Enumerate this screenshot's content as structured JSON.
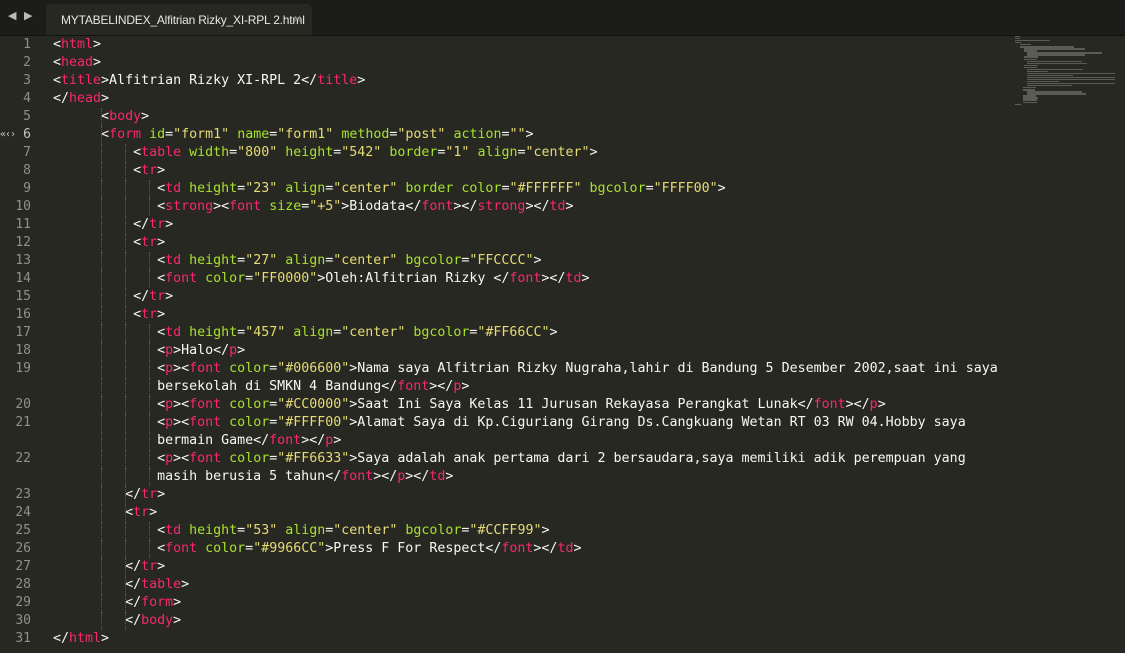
{
  "tabbar": {
    "nav_left_icon": "chevron-left-icon",
    "nav_right_icon": "chevron-right-icon",
    "tab_title": "MYTABELINDEX_Alfitrian Rizky_XI-RPL 2.html",
    "close_glyph": "×"
  },
  "colors": {
    "background": "#272822",
    "tag": "#f92672",
    "attribute": "#a6e22e",
    "string": "#e6db74",
    "text": "#f8f8f2"
  },
  "gutter": {
    "active_line": 6,
    "fold_marker_glyph": "«‹›"
  },
  "editor": {
    "lines": [
      {
        "num": "1",
        "indent": 0,
        "tokens": [
          [
            "p",
            "<"
          ],
          [
            "t",
            "html"
          ],
          [
            "p",
            ">"
          ]
        ]
      },
      {
        "num": "2",
        "indent": 0,
        "tokens": [
          [
            "p",
            "<"
          ],
          [
            "t",
            "head"
          ],
          [
            "p",
            ">"
          ]
        ]
      },
      {
        "num": "3",
        "indent": 0,
        "tokens": [
          [
            "p",
            "<"
          ],
          [
            "t",
            "title"
          ],
          [
            "p",
            ">Alfitrian Rizky XI-RPL 2</"
          ],
          [
            "t",
            "title"
          ],
          [
            "p",
            ">"
          ]
        ]
      },
      {
        "num": "4",
        "indent": 0,
        "tokens": [
          [
            "p",
            "</"
          ],
          [
            "t",
            "head"
          ],
          [
            "p",
            ">"
          ]
        ]
      },
      {
        "num": "5",
        "indent": 6,
        "tokens": [
          [
            "p",
            "<"
          ],
          [
            "t",
            "body"
          ],
          [
            "p",
            ">"
          ]
        ]
      },
      {
        "num": "6",
        "indent": 6,
        "tokens": [
          [
            "p",
            "<"
          ],
          [
            "t",
            "form"
          ],
          [
            "p",
            " "
          ],
          [
            "a",
            "id"
          ],
          [
            "p",
            "="
          ],
          [
            "s",
            "\"form1\""
          ],
          [
            "p",
            " "
          ],
          [
            "a",
            "name"
          ],
          [
            "p",
            "="
          ],
          [
            "s",
            "\"fo"
          ],
          [
            "s",
            "rm1\""
          ],
          [
            "p",
            " "
          ],
          [
            "a",
            "method"
          ],
          [
            "p",
            "="
          ],
          [
            "s",
            "\"post\""
          ],
          [
            "p",
            " "
          ],
          [
            "a",
            "action"
          ],
          [
            "p",
            "="
          ],
          [
            "s",
            "\"\""
          ],
          [
            "p",
            ">"
          ]
        ]
      },
      {
        "num": "7",
        "indent": 10,
        "tokens": [
          [
            "p",
            "<"
          ],
          [
            "t",
            "table"
          ],
          [
            "p",
            " "
          ],
          [
            "a",
            "width"
          ],
          [
            "p",
            "="
          ],
          [
            "s",
            "\"800\""
          ],
          [
            "p",
            " "
          ],
          [
            "a",
            "height"
          ],
          [
            "p",
            "="
          ],
          [
            "s",
            "\"542\""
          ],
          [
            "p",
            " "
          ],
          [
            "a",
            "border"
          ],
          [
            "p",
            "="
          ],
          [
            "s",
            "\"1\""
          ],
          [
            "p",
            " "
          ],
          [
            "a",
            "align"
          ],
          [
            "p",
            "="
          ],
          [
            "s",
            "\"center\""
          ],
          [
            "p",
            ">"
          ]
        ]
      },
      {
        "num": "8",
        "indent": 10,
        "tokens": [
          [
            "p",
            "<"
          ],
          [
            "t",
            "tr"
          ],
          [
            "p",
            ">"
          ]
        ]
      },
      {
        "num": "9",
        "indent": 13,
        "tokens": [
          [
            "p",
            "<"
          ],
          [
            "t",
            "td"
          ],
          [
            "p",
            " "
          ],
          [
            "a",
            "height"
          ],
          [
            "p",
            "="
          ],
          [
            "s",
            "\"23\""
          ],
          [
            "p",
            " "
          ],
          [
            "a",
            "align"
          ],
          [
            "p",
            "="
          ],
          [
            "s",
            "\"center\""
          ],
          [
            "p",
            " "
          ],
          [
            "a",
            "border"
          ],
          [
            "p",
            " "
          ],
          [
            "a",
            "color"
          ],
          [
            "p",
            "="
          ],
          [
            "s",
            "\"#FFFFFF\""
          ],
          [
            "p",
            " "
          ],
          [
            "a",
            "bgcolor"
          ],
          [
            "p",
            "="
          ],
          [
            "s",
            "\"FFFF00\""
          ],
          [
            "p",
            ">"
          ]
        ]
      },
      {
        "num": "10",
        "indent": 13,
        "tokens": [
          [
            "p",
            "<"
          ],
          [
            "t",
            "strong"
          ],
          [
            "p",
            "><"
          ],
          [
            "t",
            "font"
          ],
          [
            "p",
            " "
          ],
          [
            "a",
            "size"
          ],
          [
            "p",
            "="
          ],
          [
            "s",
            "\"+5\""
          ],
          [
            "p",
            ">Biodata</"
          ],
          [
            "t",
            "font"
          ],
          [
            "p",
            "></"
          ],
          [
            "t",
            "strong"
          ],
          [
            "p",
            "></"
          ],
          [
            "t",
            "td"
          ],
          [
            "p",
            ">"
          ]
        ]
      },
      {
        "num": "11",
        "indent": 10,
        "tokens": [
          [
            "p",
            "</"
          ],
          [
            "t",
            "tr"
          ],
          [
            "p",
            ">"
          ]
        ]
      },
      {
        "num": "12",
        "indent": 10,
        "tokens": [
          [
            "p",
            "<"
          ],
          [
            "t",
            "tr"
          ],
          [
            "p",
            ">"
          ]
        ]
      },
      {
        "num": "13",
        "indent": 13,
        "tokens": [
          [
            "p",
            "<"
          ],
          [
            "t",
            "td"
          ],
          [
            "p",
            " "
          ],
          [
            "a",
            "height"
          ],
          [
            "p",
            "="
          ],
          [
            "s",
            "\"27\""
          ],
          [
            "p",
            " "
          ],
          [
            "a",
            "align"
          ],
          [
            "p",
            "="
          ],
          [
            "s",
            "\"center\""
          ],
          [
            "p",
            " "
          ],
          [
            "a",
            "bgcolor"
          ],
          [
            "p",
            "="
          ],
          [
            "s",
            "\"FFCCCC\""
          ],
          [
            "p",
            ">"
          ]
        ]
      },
      {
        "num": "14",
        "indent": 13,
        "tokens": [
          [
            "p",
            "<"
          ],
          [
            "t",
            "font"
          ],
          [
            "p",
            " "
          ],
          [
            "a",
            "color"
          ],
          [
            "p",
            "="
          ],
          [
            "s",
            "\"FF0000\""
          ],
          [
            "p",
            ">Oleh:Alfitrian Rizky </"
          ],
          [
            "t",
            "font"
          ],
          [
            "p",
            "></"
          ],
          [
            "t",
            "td"
          ],
          [
            "p",
            ">"
          ]
        ]
      },
      {
        "num": "15",
        "indent": 10,
        "tokens": [
          [
            "p",
            "</"
          ],
          [
            "t",
            "tr"
          ],
          [
            "p",
            ">"
          ]
        ]
      },
      {
        "num": "16",
        "indent": 10,
        "tokens": [
          [
            "p",
            "<"
          ],
          [
            "t",
            "tr"
          ],
          [
            "p",
            ">"
          ]
        ]
      },
      {
        "num": "17",
        "indent": 13,
        "tokens": [
          [
            "p",
            "<"
          ],
          [
            "t",
            "td"
          ],
          [
            "p",
            " "
          ],
          [
            "a",
            "height"
          ],
          [
            "p",
            "="
          ],
          [
            "s",
            "\"457\""
          ],
          [
            "p",
            " "
          ],
          [
            "a",
            "align"
          ],
          [
            "p",
            "="
          ],
          [
            "s",
            "\"center\""
          ],
          [
            "p",
            " "
          ],
          [
            "a",
            "bgcolor"
          ],
          [
            "p",
            "="
          ],
          [
            "s",
            "\"#FF66CC\""
          ],
          [
            "p",
            ">"
          ]
        ]
      },
      {
        "num": "18",
        "indent": 13,
        "tokens": [
          [
            "p",
            "<"
          ],
          [
            "t",
            "p"
          ],
          [
            "p",
            ">Halo</"
          ],
          [
            "t",
            "p"
          ],
          [
            "p",
            ">"
          ]
        ]
      },
      {
        "num": "19",
        "indent": 13,
        "tokens": [
          [
            "p",
            "<"
          ],
          [
            "t",
            "p"
          ],
          [
            "p",
            "><"
          ],
          [
            "t",
            "font"
          ],
          [
            "p",
            " "
          ],
          [
            "a",
            "color"
          ],
          [
            "p",
            "="
          ],
          [
            "s",
            "\"#006600\""
          ],
          [
            "p",
            ">Nama saya Alfitrian Rizky Nugraha,lahir di Bandung 5 Desember 2002,saat ini saya"
          ]
        ]
      },
      {
        "num": "",
        "indent": 13,
        "tokens": [
          [
            "p",
            "bersekolah di SMKN 4 Bandung</"
          ],
          [
            "t",
            "font"
          ],
          [
            "p",
            "></"
          ],
          [
            "t",
            "p"
          ],
          [
            "p",
            ">"
          ]
        ]
      },
      {
        "num": "20",
        "indent": 13,
        "tokens": [
          [
            "p",
            "<"
          ],
          [
            "t",
            "p"
          ],
          [
            "p",
            "><"
          ],
          [
            "t",
            "font"
          ],
          [
            "p",
            " "
          ],
          [
            "a",
            "color"
          ],
          [
            "p",
            "="
          ],
          [
            "s",
            "\"#CC0000\""
          ],
          [
            "p",
            ">Saat Ini Saya Kelas 11 Jurusan Rekayasa Perangkat Lunak</"
          ],
          [
            "t",
            "font"
          ],
          [
            "p",
            "></"
          ],
          [
            "t",
            "p"
          ],
          [
            "p",
            ">"
          ]
        ]
      },
      {
        "num": "21",
        "indent": 13,
        "tokens": [
          [
            "p",
            "<"
          ],
          [
            "t",
            "p"
          ],
          [
            "p",
            "><"
          ],
          [
            "t",
            "font"
          ],
          [
            "p",
            " "
          ],
          [
            "a",
            "color"
          ],
          [
            "p",
            "="
          ],
          [
            "s",
            "\"#FFFF00\""
          ],
          [
            "p",
            ">Alamat Saya di Kp.Ciguriang Girang Ds.Cangkuang Wetan RT 03 RW 04.Hobby saya"
          ]
        ]
      },
      {
        "num": "",
        "indent": 13,
        "tokens": [
          [
            "p",
            "bermain Game</"
          ],
          [
            "t",
            "font"
          ],
          [
            "p",
            "></"
          ],
          [
            "t",
            "p"
          ],
          [
            "p",
            ">"
          ]
        ]
      },
      {
        "num": "22",
        "indent": 13,
        "tokens": [
          [
            "p",
            "<"
          ],
          [
            "t",
            "p"
          ],
          [
            "p",
            "><"
          ],
          [
            "t",
            "font"
          ],
          [
            "p",
            " "
          ],
          [
            "a",
            "color"
          ],
          [
            "p",
            "="
          ],
          [
            "s",
            "\"#FF6633\""
          ],
          [
            "p",
            ">Saya adalah anak pertama dari 2 bersaudara,saya memiliki adik perempuan yang"
          ]
        ]
      },
      {
        "num": "",
        "indent": 13,
        "tokens": [
          [
            "p",
            "masih berusia 5 tahun</"
          ],
          [
            "t",
            "font"
          ],
          [
            "p",
            "></"
          ],
          [
            "t",
            "p"
          ],
          [
            "p",
            "></"
          ],
          [
            "t",
            "td"
          ],
          [
            "p",
            ">"
          ]
        ]
      },
      {
        "num": "23",
        "indent": 9,
        "tokens": [
          [
            "p",
            "</"
          ],
          [
            "t",
            "tr"
          ],
          [
            "p",
            ">"
          ]
        ]
      },
      {
        "num": "24",
        "indent": 9,
        "tokens": [
          [
            "p",
            "<"
          ],
          [
            "t",
            "tr"
          ],
          [
            "p",
            ">"
          ]
        ]
      },
      {
        "num": "25",
        "indent": 13,
        "tokens": [
          [
            "p",
            "<"
          ],
          [
            "t",
            "td"
          ],
          [
            "p",
            " "
          ],
          [
            "a",
            "height"
          ],
          [
            "p",
            "="
          ],
          [
            "s",
            "\"53\""
          ],
          [
            "p",
            " "
          ],
          [
            "a",
            "align"
          ],
          [
            "p",
            "="
          ],
          [
            "s",
            "\"center\""
          ],
          [
            "p",
            " "
          ],
          [
            "a",
            "bgcolor"
          ],
          [
            "p",
            "="
          ],
          [
            "s",
            "\"#CCFF99\""
          ],
          [
            "p",
            ">"
          ]
        ]
      },
      {
        "num": "26",
        "indent": 13,
        "tokens": [
          [
            "p",
            "<"
          ],
          [
            "t",
            "font"
          ],
          [
            "p",
            " "
          ],
          [
            "a",
            "color"
          ],
          [
            "p",
            "="
          ],
          [
            "s",
            "\"#9966CC\""
          ],
          [
            "p",
            ">Press F For Respect</"
          ],
          [
            "t",
            "font"
          ],
          [
            "p",
            "></"
          ],
          [
            "t",
            "td"
          ],
          [
            "p",
            ">"
          ]
        ]
      },
      {
        "num": "27",
        "indent": 9,
        "tokens": [
          [
            "p",
            "</"
          ],
          [
            "t",
            "tr"
          ],
          [
            "p",
            ">"
          ]
        ]
      },
      {
        "num": "28",
        "indent": 9,
        "tokens": [
          [
            "p",
            "</"
          ],
          [
            "t",
            "table"
          ],
          [
            "p",
            ">"
          ]
        ]
      },
      {
        "num": "29",
        "indent": 9,
        "tokens": [
          [
            "p",
            "</"
          ],
          [
            "t",
            "form"
          ],
          [
            "p",
            ">"
          ]
        ]
      },
      {
        "num": "30",
        "indent": 9,
        "tokens": [
          [
            "p",
            "</"
          ],
          [
            "t",
            "body"
          ],
          [
            "p",
            ">"
          ]
        ]
      },
      {
        "num": "31",
        "indent": 0,
        "tokens": [
          [
            "p",
            "</"
          ],
          [
            "t",
            "html"
          ],
          [
            "p",
            ">"
          ]
        ]
      }
    ]
  }
}
